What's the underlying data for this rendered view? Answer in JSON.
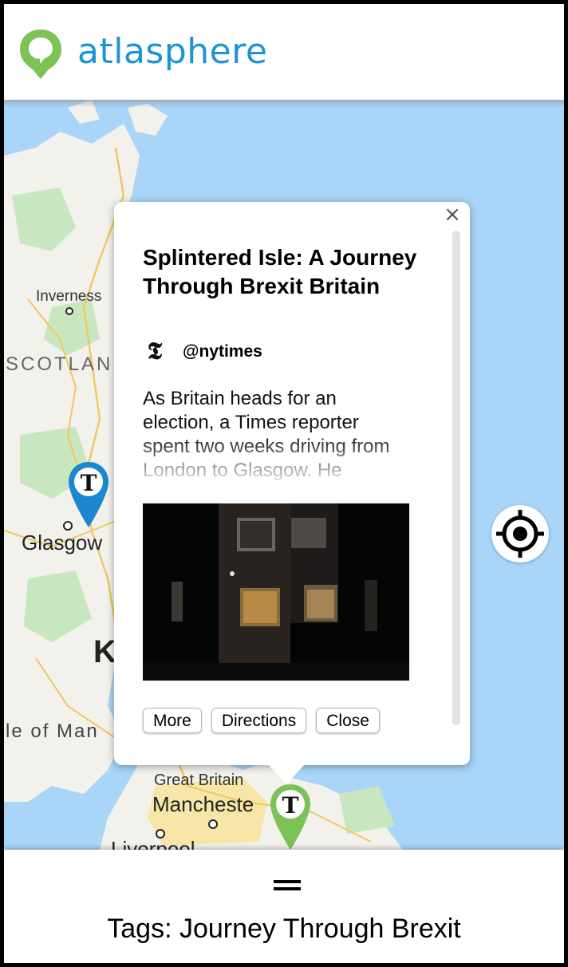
{
  "header": {
    "brand_name": "atlasphere",
    "logo_icon": "speech-bubble-pin-icon",
    "brand_color": "#1b95d5",
    "logo_color": "#7cc257"
  },
  "map": {
    "water_color": "#a8d5f8",
    "land_color": "#f3f1ec",
    "labels": {
      "inverness": "Inverness",
      "scotland": "SCOTLAN",
      "glasgow": "Glasgow",
      "kingdom": "K",
      "isle_of_man": "le of Man",
      "great_britain": "Great Britain",
      "manchester": "Mancheste",
      "liverpool": "Liverpool"
    },
    "pins": {
      "glasgow_pin": {
        "icon": "nytimes-logo-icon",
        "color": "#1b87d0"
      },
      "manchester_pin": {
        "icon": "nytimes-logo-icon",
        "color": "#7cc257"
      }
    }
  },
  "popup": {
    "title": "Splintered Isle: A Journey Through Brexit Britain",
    "source_icon": "nytimes-logo-icon",
    "source_icon_glyph": "𝕿",
    "source_handle": "@nytimes",
    "description": "As Britain heads for an election, a Times reporter spent two weeks driving from London to Glasgow. He",
    "close_icon": "close-icon",
    "close_glyph": "×",
    "buttons": {
      "more": "More",
      "directions": "Directions",
      "close": "Close"
    }
  },
  "locate_button": {
    "icon": "crosshair-icon"
  },
  "bottom_panel": {
    "drag_icon": "drag-handle-icon",
    "tags_text": "Tags: Journey Through Brexit"
  }
}
